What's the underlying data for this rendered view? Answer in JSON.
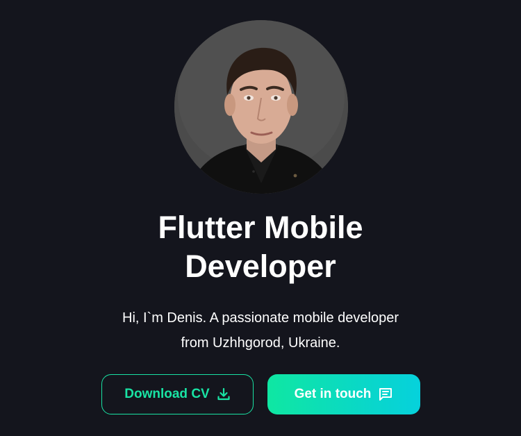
{
  "hero": {
    "avatar_alt": "Portrait photo",
    "title_line1": "Flutter Mobile",
    "title_line2": "Developer",
    "description_line1": "Hi, I`m Denis. A passionate mobile developer",
    "description_line2": "from Uzhhgorod, Ukraine."
  },
  "buttons": {
    "download_cv": {
      "label": "Download CV",
      "icon": "download-icon"
    },
    "get_in_touch": {
      "label": "Get in touch",
      "icon": "chat-icon"
    }
  },
  "colors": {
    "background": "#14151d",
    "accent": "#19e3a4",
    "gradient_start": "#0fe7a2",
    "gradient_end": "#06d1dc",
    "text": "#ffffff"
  }
}
